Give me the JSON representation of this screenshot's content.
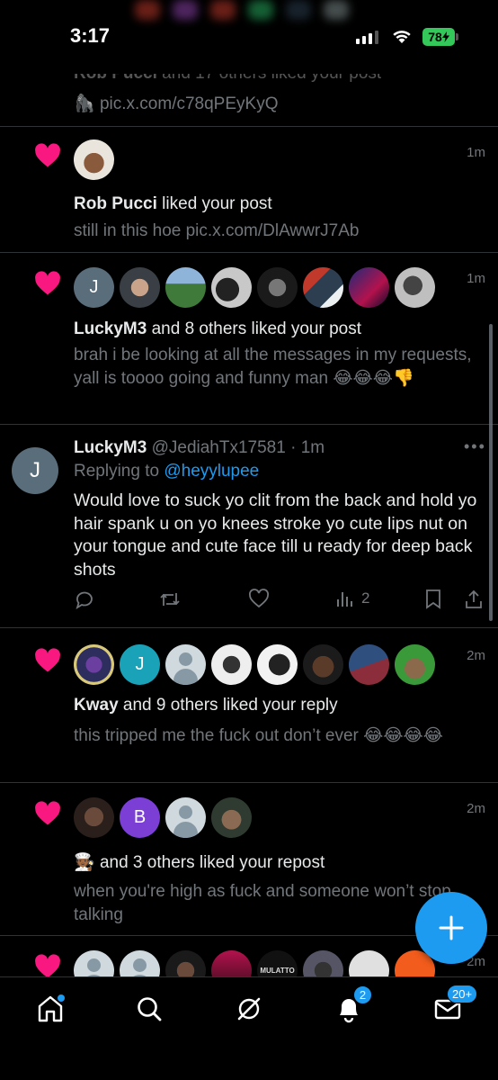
{
  "status_bar": {
    "time": "3:17",
    "battery": "78"
  },
  "feed": {
    "top_partial": {
      "title_name": "Rob Pucci",
      "title_rest": " and 17 others liked your post",
      "emoji": "🦍",
      "snippet": "pic.x.com/c78qPEyKyQ"
    },
    "notifications": [
      {
        "time": "1m",
        "title_name": "Rob Pucci",
        "title_rest": " liked your post",
        "snippet": "still in this hoe pic.x.com/DlAwwrJ7Ab"
      },
      {
        "time": "1m",
        "title_name": "LuckyM3",
        "title_rest": " and 8 others liked your post",
        "snippet": "brah i be looking at all the messages in my requests, yall is toooo going and funny man 😂😂😂👎",
        "avatar_letter": "J"
      },
      {
        "time": "2m",
        "title_name": "Kway",
        "title_rest": " and 9 others liked your reply",
        "snippet": "this tripped me the fuck out don’t ever 😂😂😂😂",
        "avatar_letter": "J"
      },
      {
        "time": "2m",
        "title_name": "🧑🏾‍🍳",
        "title_rest": " and 3 others liked your repost",
        "snippet": "when you're high as fuck and someone won’t stop talking",
        "avatar_letter": "B"
      },
      {
        "time": "2m",
        "avatar_text": "MULATTO"
      }
    ],
    "reply_tweet": {
      "avatar_letter": "J",
      "name": "LuckyM3",
      "meta": " @JediahTx17581 · 1m",
      "replying_label": "Replying to ",
      "replying_handle": "@heyylupee",
      "body": "Would love to suck yo clit from the back and hold yo hair spank u on yo knees stroke yo cute lips nut on your tongue and cute face till u ready for deep back shots",
      "views": "2"
    }
  },
  "tabbar": {
    "notifications_badge": "2",
    "messages_badge": "20+"
  },
  "colors": {
    "accent": "#1d9bf0",
    "heart": "#f91880",
    "muted": "#71767b",
    "divider": "#2f3336"
  }
}
